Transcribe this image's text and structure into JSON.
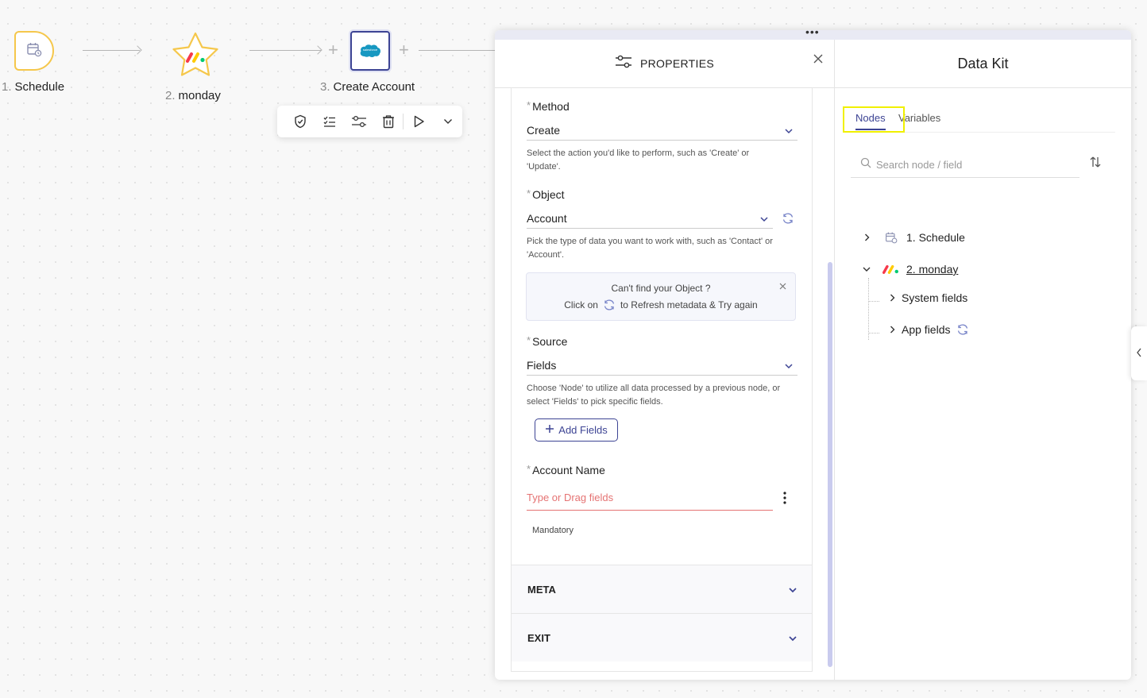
{
  "flow": {
    "nodes": [
      {
        "num": "1.",
        "label": "Schedule",
        "icon": "calendar-clock-icon"
      },
      {
        "num": "2.",
        "label": "monday",
        "icon": "monday-logo-icon"
      },
      {
        "num": "3.",
        "label": "Create Account",
        "icon": "salesforce-logo-icon"
      }
    ],
    "salesforce_text": "salesforce"
  },
  "toolbar": {
    "icons": [
      "shield-check-icon",
      "checklist-icon",
      "sliders-icon",
      "trash-icon",
      "play-icon",
      "chevron-down-icon"
    ]
  },
  "properties": {
    "title": "PROPERTIES",
    "method": {
      "label": "Method",
      "value": "Create",
      "hint": "Select the action you'd like to perform, such as 'Create' or 'Update'."
    },
    "object": {
      "label": "Object",
      "value": "Account",
      "hint": "Pick the type of data you want to work with, such as 'Contact' or 'Account'."
    },
    "info": {
      "line1": "Can't find your Object ?",
      "line2a": "Click on",
      "line2b": "to Refresh metadata & Try again"
    },
    "source": {
      "label": "Source",
      "value": "Fields",
      "hint": "Choose 'Node' to utilize all data processed by a previous node, or select 'Fields' to pick specific fields."
    },
    "add_fields": "Add Fields",
    "account_name": {
      "label": "Account Name",
      "placeholder": "Type or Drag fields",
      "note": "Mandatory"
    },
    "sections": [
      "META",
      "EXIT"
    ],
    "required_mark": "*"
  },
  "datakit": {
    "title": "Data Kit",
    "tabs": [
      "Nodes",
      "Variables"
    ],
    "active_tab": "Nodes",
    "search_placeholder": "Search node / field",
    "tree": {
      "schedule": "1. Schedule",
      "monday": "2. monday",
      "system_fields": "System fields",
      "app_fields": "App fields"
    }
  },
  "colors": {
    "accent": "#3d4494",
    "node_border": "#f5c74b",
    "error": "#e57373",
    "highlight": "#f0f000"
  }
}
